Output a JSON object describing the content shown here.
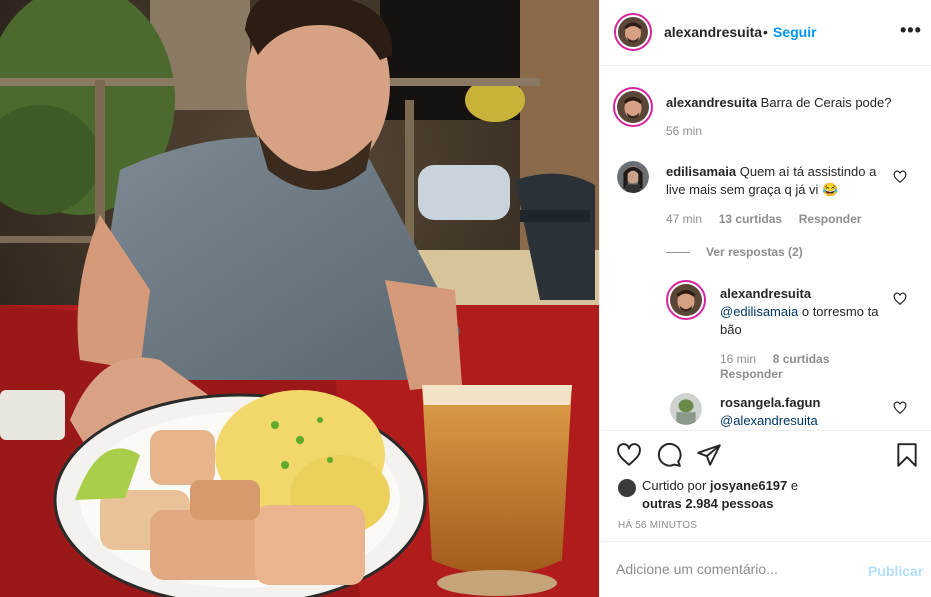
{
  "header": {
    "username": "alexandresuita",
    "separator": "•",
    "follow_label": "Seguir",
    "more_icon": "more-horizontal-icon",
    "more_label": "•••"
  },
  "caption": {
    "username": "alexandresuita",
    "text": "Barra de Cerais pode?",
    "time": "56 min"
  },
  "comments": [
    {
      "username": "edilisamaia",
      "text": "Quem aí tá assistindo a live mais sem graça q já vi 😂",
      "time": "47 min",
      "likes": "13 curtidas",
      "reply_label": "Responder",
      "view_replies": "Ver respostas (2)",
      "replies": [
        {
          "username": "alexandresuita",
          "mention": "@edilisamaia",
          "text": " o torresmo ta bão",
          "time": "16 min",
          "likes": "8 curtidas",
          "reply_label": "Responder"
        },
        {
          "username": "rosangela.fagun",
          "mention": "@alexandresuita",
          "text": ""
        }
      ]
    }
  ],
  "actions": {
    "icons": [
      "heart-icon",
      "comment-icon",
      "share-icon",
      "bookmark-icon"
    ],
    "liked_prefix": "Curtido por ",
    "liked_user": "josyane6197",
    "liked_mid": " e",
    "liked_others": "outras 2.984 pessoas",
    "timestamp": "HÁ 56 MINUTOS"
  },
  "add_comment": {
    "placeholder": "Adicione um comentário...",
    "post_label": "Publicar",
    "post_color": "#b2dffc"
  },
  "colors": {
    "link": "#0095f6",
    "mention": "#00376b",
    "secondary_text": "#8e8e8e",
    "story_ring": "#d6249f"
  }
}
